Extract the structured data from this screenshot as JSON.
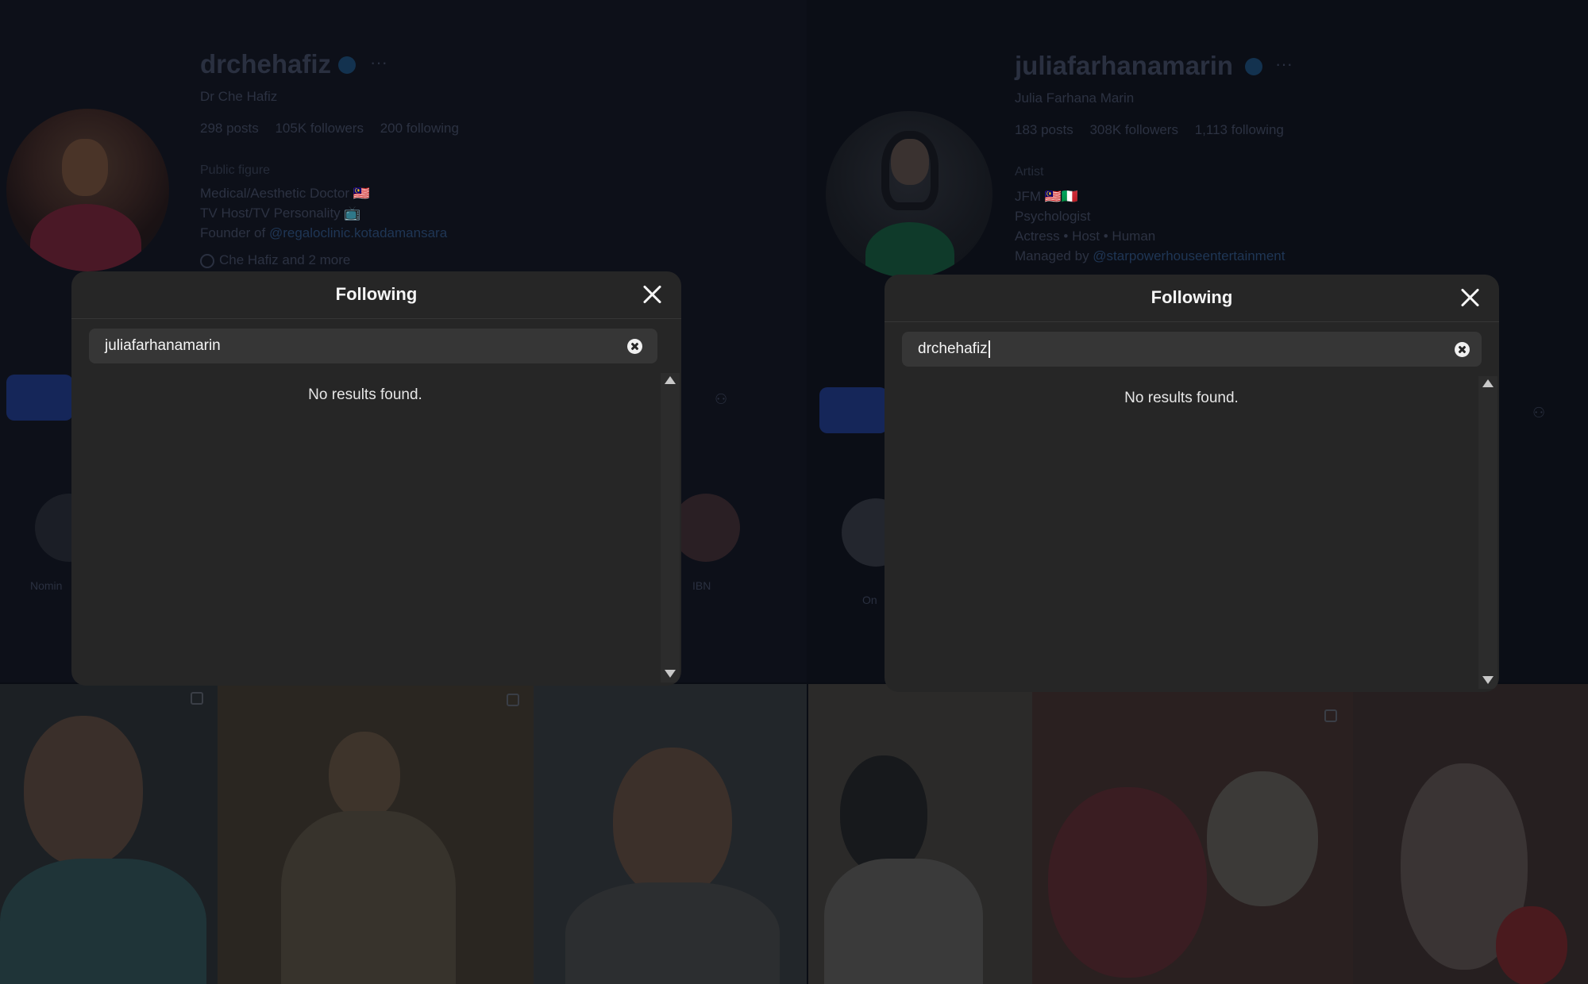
{
  "left_profile": {
    "username": "drchehafiz",
    "full_name": "Dr Che Hafiz",
    "stats": [
      "298 posts",
      "105K followers",
      "200 following"
    ],
    "category": "Public figure",
    "bio": [
      "Medical/Aesthetic Doctor 🇲🇾",
      "TV Host/TV Personality 📺"
    ],
    "founder_prefix": "Founder of ",
    "founder_link": "@regaloclinic.kotadamansara",
    "facebook_link": "Che Hafiz and 2 more",
    "highlights": [
      "Nomin",
      "IBN"
    ]
  },
  "right_profile": {
    "username": "juliafarhanamarin",
    "full_name": "Julia Farhana Marin",
    "stats": [
      "183 posts",
      "308K followers",
      "1,113 following"
    ],
    "category": "Artist",
    "bio": [
      "JFM 🇲🇾🇮🇹",
      "Psychologist",
      "Actress • Host • Human"
    ],
    "managed_prefix": "Managed by ",
    "managed_link": "@starpowerhouseentertainment",
    "highlights": [
      "On"
    ]
  },
  "modal_left": {
    "title": "Following",
    "search_value": "juliafarhanamarin",
    "empty_message": "No results found."
  },
  "modal_right": {
    "title": "Following",
    "search_value": "drchehafiz",
    "empty_message": "No results found."
  }
}
